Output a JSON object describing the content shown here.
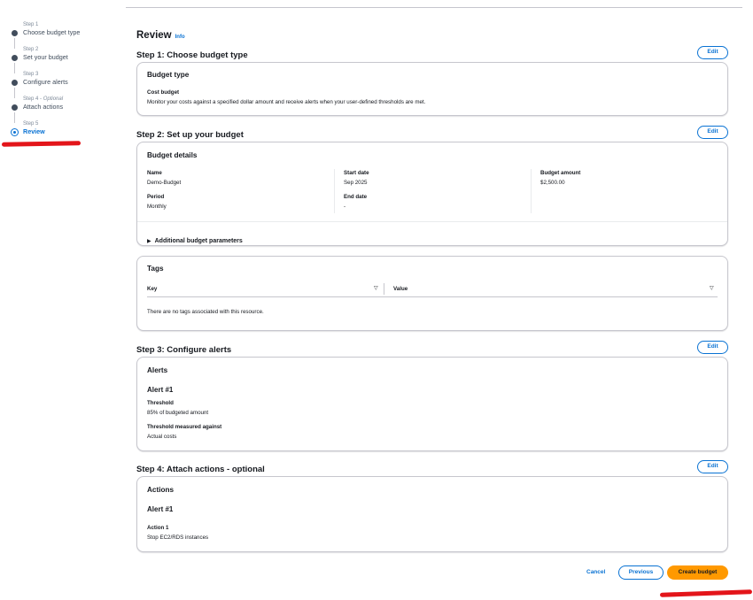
{
  "wizard": {
    "steps": [
      {
        "num": "Step 1",
        "label": "Choose budget type"
      },
      {
        "num": "Step 2",
        "label": "Set your budget"
      },
      {
        "num": "Step 3",
        "label": "Configure alerts"
      },
      {
        "num": "Step 4",
        "num_suffix": "Optional",
        "label": "Attach actions"
      },
      {
        "num": "Step 5",
        "label": "Review"
      }
    ]
  },
  "page": {
    "title": "Review",
    "info": "Info"
  },
  "edit_label": "Edit",
  "step1": {
    "heading": "Step 1: Choose budget type",
    "card_title": "Budget type",
    "key": "Cost budget",
    "desc": "Monitor your costs against a specified dollar amount and receive alerts when your user-defined thresholds are met."
  },
  "step2": {
    "heading": "Step 2: Set up your budget",
    "card_title": "Budget details",
    "name_k": "Name",
    "name_v": "Demo-Budget",
    "period_k": "Period",
    "period_v": "Monthly",
    "start_k": "Start date",
    "start_v": "Sep 2025",
    "end_k": "End date",
    "end_v": "-",
    "amount_k": "Budget amount",
    "amount_v": "$2,500.00",
    "additional": "Additional budget parameters"
  },
  "tags": {
    "title": "Tags",
    "col_key": "Key",
    "col_value": "Value",
    "empty": "There are no tags associated with this resource."
  },
  "step3": {
    "heading": "Step 3: Configure alerts",
    "card_title": "Alerts",
    "alert": "Alert #1",
    "threshold_k": "Threshold",
    "threshold_v": "85% of budgeted amount",
    "measured_k": "Threshold measured against",
    "measured_v": "Actual costs"
  },
  "step4": {
    "heading": "Step 4: Attach actions - optional",
    "card_title": "Actions",
    "alert": "Alert #1",
    "action_k": "Action 1",
    "action_v": "Stop EC2/RDS instances"
  },
  "footer": {
    "cancel": "Cancel",
    "previous": "Previous",
    "create": "Create budget"
  }
}
